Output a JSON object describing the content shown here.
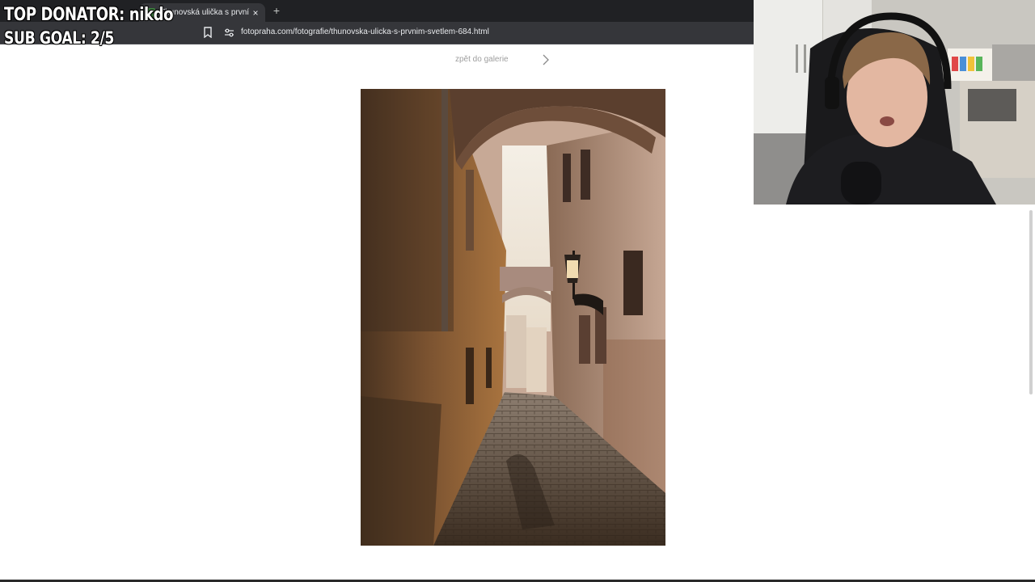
{
  "overlay": {
    "top_donator": "TOP DONATOR: nikdo",
    "sub_goal": "SUB GOAL: 2/5"
  },
  "browser": {
    "active_tab_title": "Thunovská ulička s prvním světl",
    "close_glyph": "×",
    "new_tab_glyph": "+",
    "url": "fotopraha.com/fotografie/thunovska-ulicka-s-prvnim-svetlem-684.html"
  },
  "page": {
    "back_link": "zpět do galerie"
  },
  "icons": {
    "bookmark": "bookmark-icon",
    "site_info": "tune-icon",
    "next": "chevron-right-icon",
    "close": "close-icon",
    "new_tab": "plus-icon"
  },
  "colors": {
    "chrome_dark": "#202124",
    "toolbar": "#35363a",
    "link_gray": "#9e9e9e"
  }
}
